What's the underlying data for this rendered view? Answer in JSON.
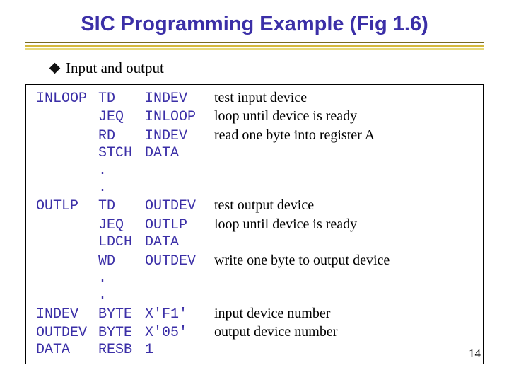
{
  "title": "SIC Programming Example (Fig 1.6)",
  "subtitle": "Input and output",
  "page_number": "14",
  "code": {
    "r0": {
      "label": "INLOOP",
      "op": "TD",
      "arg": "INDEV",
      "comment": "test input device"
    },
    "r1": {
      "label": "",
      "op": "JEQ",
      "arg": "INLOOP",
      "comment": "loop until device is ready"
    },
    "r2": {
      "label": "",
      "op": "RD",
      "arg": "INDEV",
      "comment": "read one byte into register A"
    },
    "r3": {
      "label": "",
      "op": "STCH",
      "arg": "DATA",
      "comment": ""
    },
    "r4": {
      "label": "",
      "op": ".",
      "arg": "",
      "comment": ""
    },
    "r5": {
      "label": "",
      "op": ".",
      "arg": "",
      "comment": ""
    },
    "r6": {
      "label": "OUTLP",
      "op": "TD",
      "arg": "OUTDEV",
      "comment": "test output device"
    },
    "r7": {
      "label": "",
      "op": "JEQ",
      "arg": "OUTLP",
      "comment": "loop until device is ready"
    },
    "r8": {
      "label": "",
      "op": "LDCH",
      "arg": "DATA",
      "comment": ""
    },
    "r9": {
      "label": "",
      "op": "WD",
      "arg": "OUTDEV",
      "comment": "write one byte to output device"
    },
    "r10": {
      "label": "",
      "op": ".",
      "arg": "",
      "comment": ""
    },
    "r11": {
      "label": "",
      "op": ".",
      "arg": "",
      "comment": ""
    },
    "r12": {
      "label": "INDEV",
      "op": "BYTE",
      "arg": "X'F1'",
      "comment": "input device number"
    },
    "r13": {
      "label": "OUTDEV",
      "op": "BYTE",
      "arg": "X'05'",
      "comment": "output device number"
    },
    "r14": {
      "label": "DATA",
      "op": "RESB",
      "arg": "1",
      "comment": ""
    }
  }
}
